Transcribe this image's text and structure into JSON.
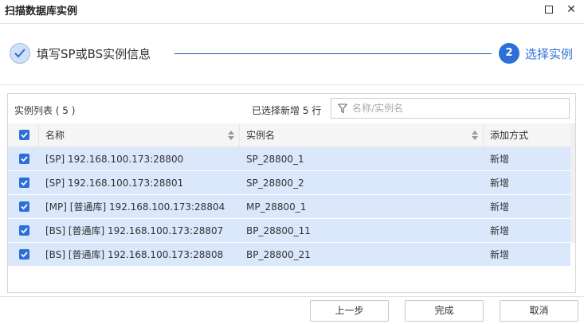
{
  "window": {
    "title": "扫描数据库实例",
    "maximize_icon": "maximize-icon",
    "close_icon": "close-icon",
    "close_glyph": "✕"
  },
  "stepper": {
    "step1": {
      "icon": "check-icon",
      "label": "填写SP或BS实例信息",
      "status": "done"
    },
    "step2": {
      "number": "2",
      "label": "选择实例",
      "status": "active"
    },
    "accent_color": "#2d6fd8"
  },
  "panel": {
    "list_title": "实例列表 ( 5 )",
    "selected_info": "已选择新增 5 行",
    "search": {
      "icon": "filter-icon",
      "placeholder": "名称/实例名",
      "value": ""
    }
  },
  "table": {
    "columns": [
      {
        "label": "名称",
        "sortable": true
      },
      {
        "label": "实例名",
        "sortable": true
      },
      {
        "label": "添加方式",
        "sortable": false
      }
    ],
    "header_checkbox_checked": true,
    "rows": [
      {
        "checked": true,
        "name": "[SP] 192.168.100.173:28800",
        "instance": "SP_28800_1",
        "mode": "新增"
      },
      {
        "checked": true,
        "name": "[SP] 192.168.100.173:28801",
        "instance": "SP_28800_2",
        "mode": "新增"
      },
      {
        "checked": true,
        "name": "[MP] [普通库] 192.168.100.173:28804",
        "instance": "MP_28800_1",
        "mode": "新增"
      },
      {
        "checked": true,
        "name": "[BS] [普通库] 192.168.100.173:28807",
        "instance": "BP_28800_11",
        "mode": "新增"
      },
      {
        "checked": true,
        "name": "[BS] [普通库] 192.168.100.173:28808",
        "instance": "BP_28800_21",
        "mode": "新增"
      }
    ],
    "selected_row_color": "#dbe8fb"
  },
  "footer": {
    "prev_label": "上一步",
    "done_label": "完成",
    "cancel_label": "取消"
  }
}
